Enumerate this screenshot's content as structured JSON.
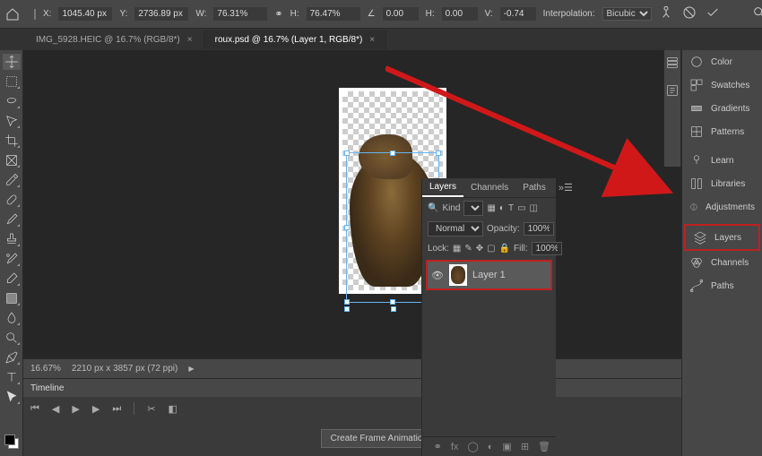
{
  "topbar": {
    "x_label": "X:",
    "x_value": "1045.40 px",
    "y_label": "Y:",
    "y_value": "2736.89 px",
    "w_label": "W:",
    "w_value": "76.31%",
    "h_label": "H:",
    "h_value": "76.47%",
    "angle_label": "∠",
    "angle_value": "0.00",
    "skew_h_label": "H:",
    "skew_h_value": "0.00",
    "skew_v_label": "V:",
    "skew_v_value": "-0.74",
    "interp_label": "Interpolation:",
    "interp_value": "Bicubic"
  },
  "tabs": [
    {
      "label": "IMG_5928.HEIC @ 16.7% (RGB/8*)",
      "active": false
    },
    {
      "label": "roux.psd @ 16.7% (Layer 1, RGB/8*)",
      "active": true
    }
  ],
  "status": {
    "zoom": "16.67%",
    "doc_info": "2210 px x 3857 px (72 ppi)"
  },
  "timeline": {
    "title": "Timeline",
    "create_button": "Create Frame Animation"
  },
  "layers_panel": {
    "tabs": [
      "Layers",
      "Channels",
      "Paths"
    ],
    "kind_label": "Kind",
    "blend_mode": "Normal",
    "opacity_label": "Opacity:",
    "opacity_value": "100%",
    "lock_label": "Lock:",
    "fill_label": "Fill:",
    "fill_value": "100%",
    "layers": [
      {
        "name": "Layer 1",
        "visible": true
      }
    ]
  },
  "right_panels": {
    "group1": [
      "Color",
      "Swatches",
      "Gradients",
      "Patterns"
    ],
    "group2": [
      "Learn",
      "Libraries",
      "Adjustments"
    ],
    "group3": [
      "Layers",
      "Channels",
      "Paths"
    ]
  },
  "highlight": {
    "color": "#c02020"
  }
}
